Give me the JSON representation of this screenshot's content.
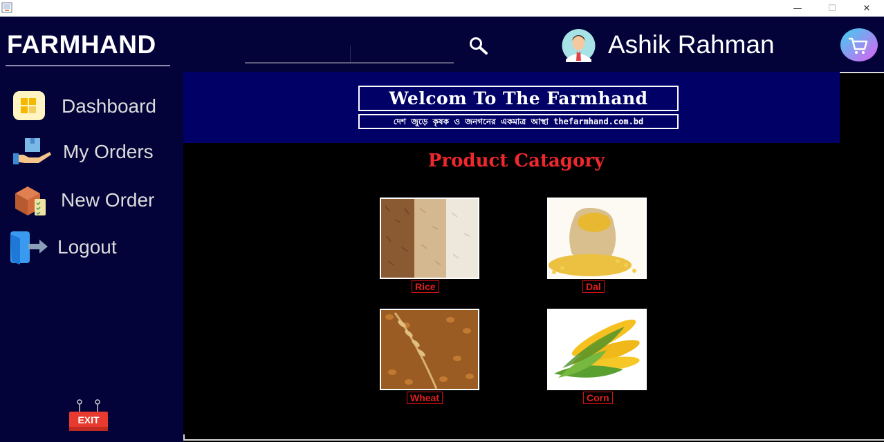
{
  "app": {
    "brand": "FARMHAND"
  },
  "sidebar": {
    "items": [
      {
        "label": "Dashboard",
        "icon": "dashboard-icon"
      },
      {
        "label": "My Orders",
        "icon": "orders-icon"
      },
      {
        "label": "New Order",
        "icon": "new-order-icon"
      },
      {
        "label": "Logout",
        "icon": "logout-icon"
      }
    ],
    "exit_label": "EXIT"
  },
  "header": {
    "search": {
      "value": "",
      "placeholder": ""
    },
    "user_name": "Ashik Rahman"
  },
  "banner": {
    "title": "Welcom To The Farmhand",
    "subtitle": "দেশ জুড়ে কৃষক ও জনগনের একমাত্র আস্থা thefarmhand.com.bd"
  },
  "content": {
    "section_title": "Product Catagory",
    "products": [
      {
        "label": "Rice"
      },
      {
        "label": "Dal"
      },
      {
        "label": "Wheat"
      },
      {
        "label": "Corn"
      }
    ]
  },
  "colors": {
    "sidebar_bg": "#03033a",
    "banner_bg": "#000066",
    "accent_red": "#f0282d"
  }
}
